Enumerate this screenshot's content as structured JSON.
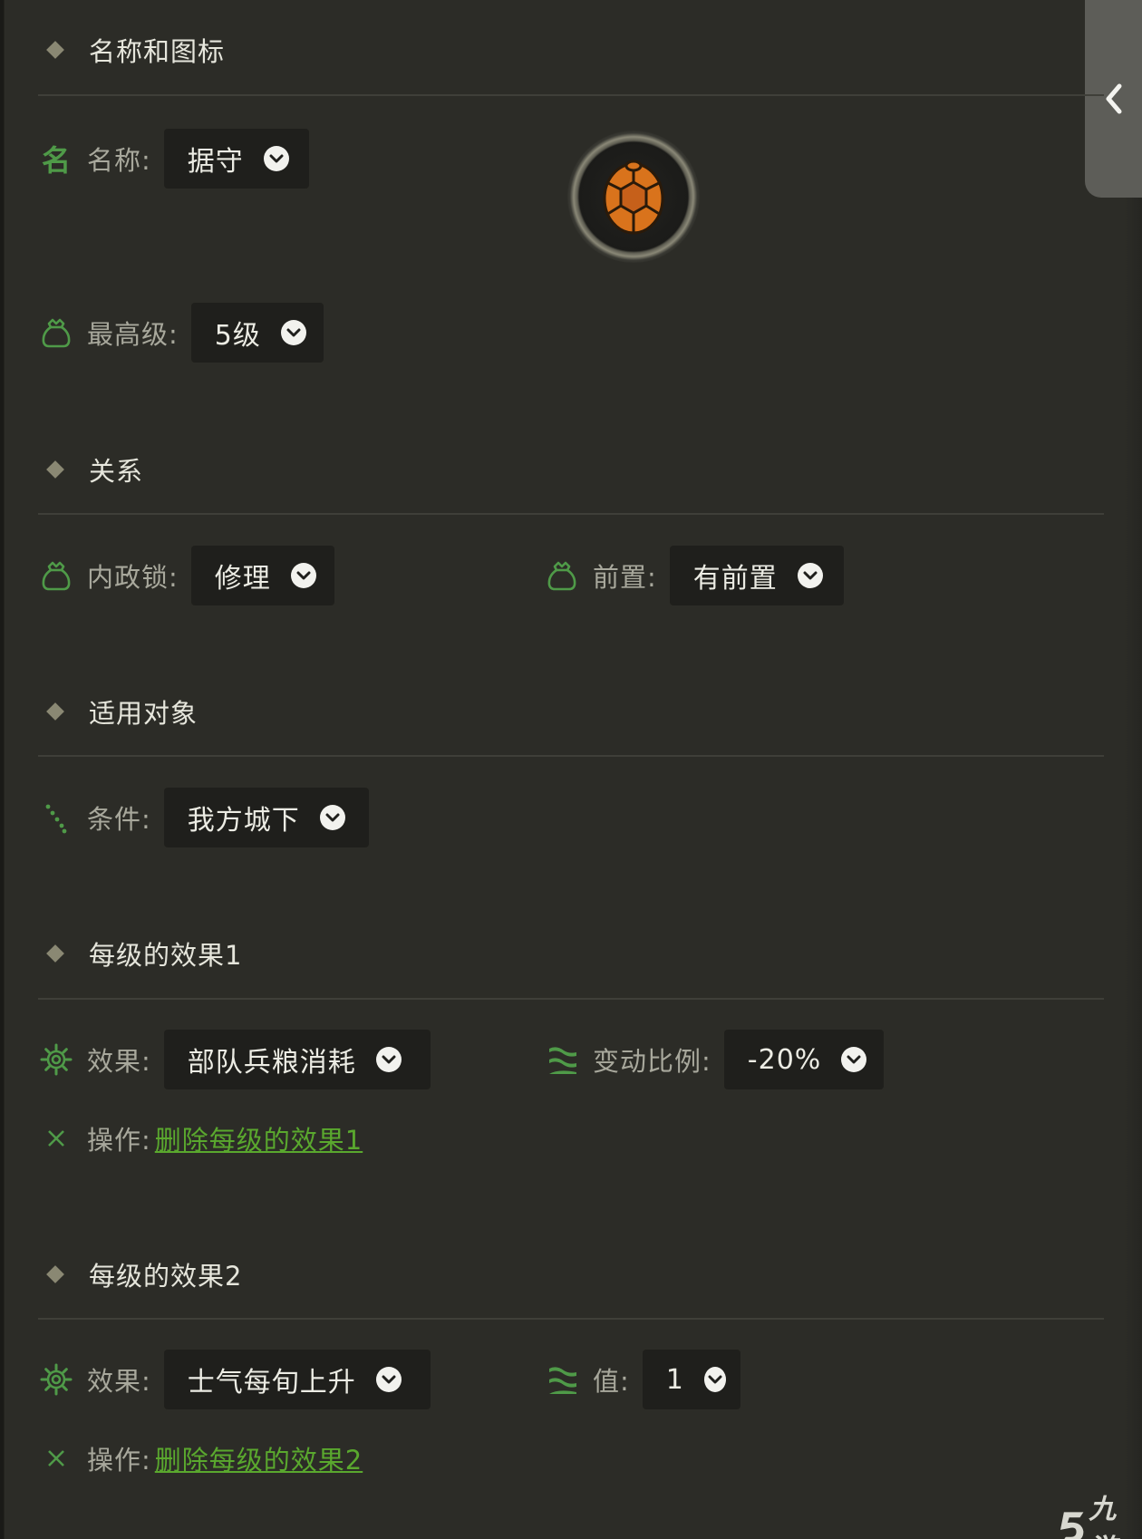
{
  "sections": {
    "name_icon": {
      "title": "名称和图标"
    },
    "relation": {
      "title": "关系"
    },
    "target": {
      "title": "适用对象"
    },
    "effect1": {
      "title": "每级的效果1"
    },
    "effect2": {
      "title": "每级的效果2"
    }
  },
  "fields": {
    "name": {
      "icon_text": "名",
      "label": "名称:",
      "value": "据守"
    },
    "max_level": {
      "label": "最高级:",
      "value": "5级"
    },
    "domestic_lock": {
      "label": "内政锁:",
      "value": "修理"
    },
    "prerequisite": {
      "label": "前置:",
      "value": "有前置"
    },
    "condition": {
      "label": "条件:",
      "value": "我方城下"
    },
    "effect1": {
      "effect_label": "效果:",
      "effect_value": "部队兵粮消耗",
      "ratio_label": "变动比例:",
      "ratio_value": "-20%",
      "op_label": "操作:",
      "op_link": "删除每级的效果1"
    },
    "effect2": {
      "effect_label": "效果:",
      "effect_value": "士气每旬上升",
      "value_label": "值:",
      "value_value": "1",
      "op_label": "操作:",
      "op_link": "删除每级的效果2"
    }
  },
  "watermark": {
    "text": "九游"
  },
  "colors": {
    "background": "#2c2c27",
    "accent_green": "#4f9a48",
    "link_green": "#5aa82e",
    "skill_icon_orange": "#d9731c"
  },
  "icons": {
    "collapse": "chevron-left-icon",
    "skill": "turtle-shell-icon",
    "level": "pouch-icon",
    "condition": "footprints-icon",
    "effect": "gear-icon",
    "ratio": "wave-flag-icon",
    "delete": "x-icon",
    "dropdown": "chevron-down-icon"
  }
}
